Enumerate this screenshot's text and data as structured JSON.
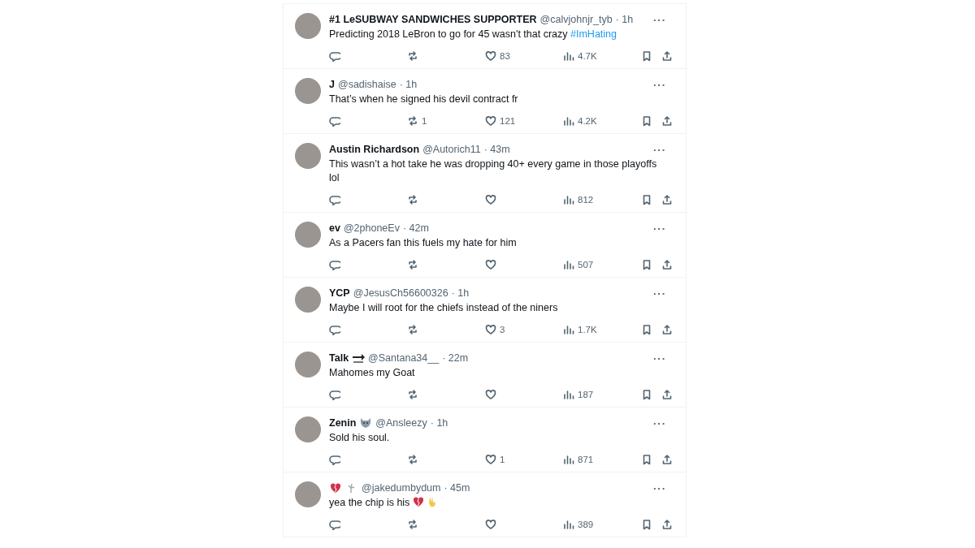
{
  "replies": [
    {
      "name": "#1 LeSUBWAY SANDWICHES SUPPORTER",
      "handle": "@calvjohnjr_tyb",
      "time": "· 1h",
      "more": "···",
      "text": "Predicting 2018 LeBron to go for 45 wasn't that crazy",
      "hashtag": "#ImHating",
      "likes": "83",
      "views": "4.7K"
    },
    {
      "name": "J",
      "handle": "@sadishaise",
      "time": "· 1h",
      "more": "···",
      "text": "That’s when he signed his devil contract fr",
      "reposts": "1",
      "likes": "121",
      "views": "4.2K"
    },
    {
      "name": "Austin Richardson",
      "handle": "@Autorich11",
      "time": "· 43m",
      "more": "···",
      "text": "This wasn’t a hot take he was dropping 40+ every game in those playoffs lol",
      "views": "812"
    },
    {
      "name": "ev",
      "handle": "@2phoneEv",
      "time": "· 42m",
      "more": "···",
      "text": "As a Pacers fan this fuels my hate for him",
      "views": "507"
    },
    {
      "name": "YCP",
      "handle": "@JesusCh56600326",
      "time": "· 1h",
      "more": "···",
      "text": "Maybe I will root for the chiefs instead of the niners",
      "likes": "3",
      "views": "1.7K"
    },
    {
      "name": "Talk",
      "badges": [
        {
          "kind": "arrow"
        }
      ],
      "handle": "@Santana34__",
      "time": "· 22m",
      "more": "···",
      "text": "Mahomes my Goat",
      "views": "187"
    },
    {
      "name": "Zenin",
      "badges": [
        {
          "kind": "wolf"
        }
      ],
      "handle": "@Ansleezy",
      "time": "· 1h",
      "more": "···",
      "text": "Sold his soul.",
      "likes": "1",
      "views": "871"
    },
    {
      "badges": [
        {
          "kind": "broken-heart"
        },
        {
          "kind": "plant"
        }
      ],
      "handle": "@jakedumbydum",
      "time": "· 45m",
      "more": "···",
      "text": "yea the chip is his",
      "emojis": [
        {
          "kind": "broken-heart"
        },
        {
          "kind": "peace"
        }
      ],
      "views": "389"
    }
  ]
}
